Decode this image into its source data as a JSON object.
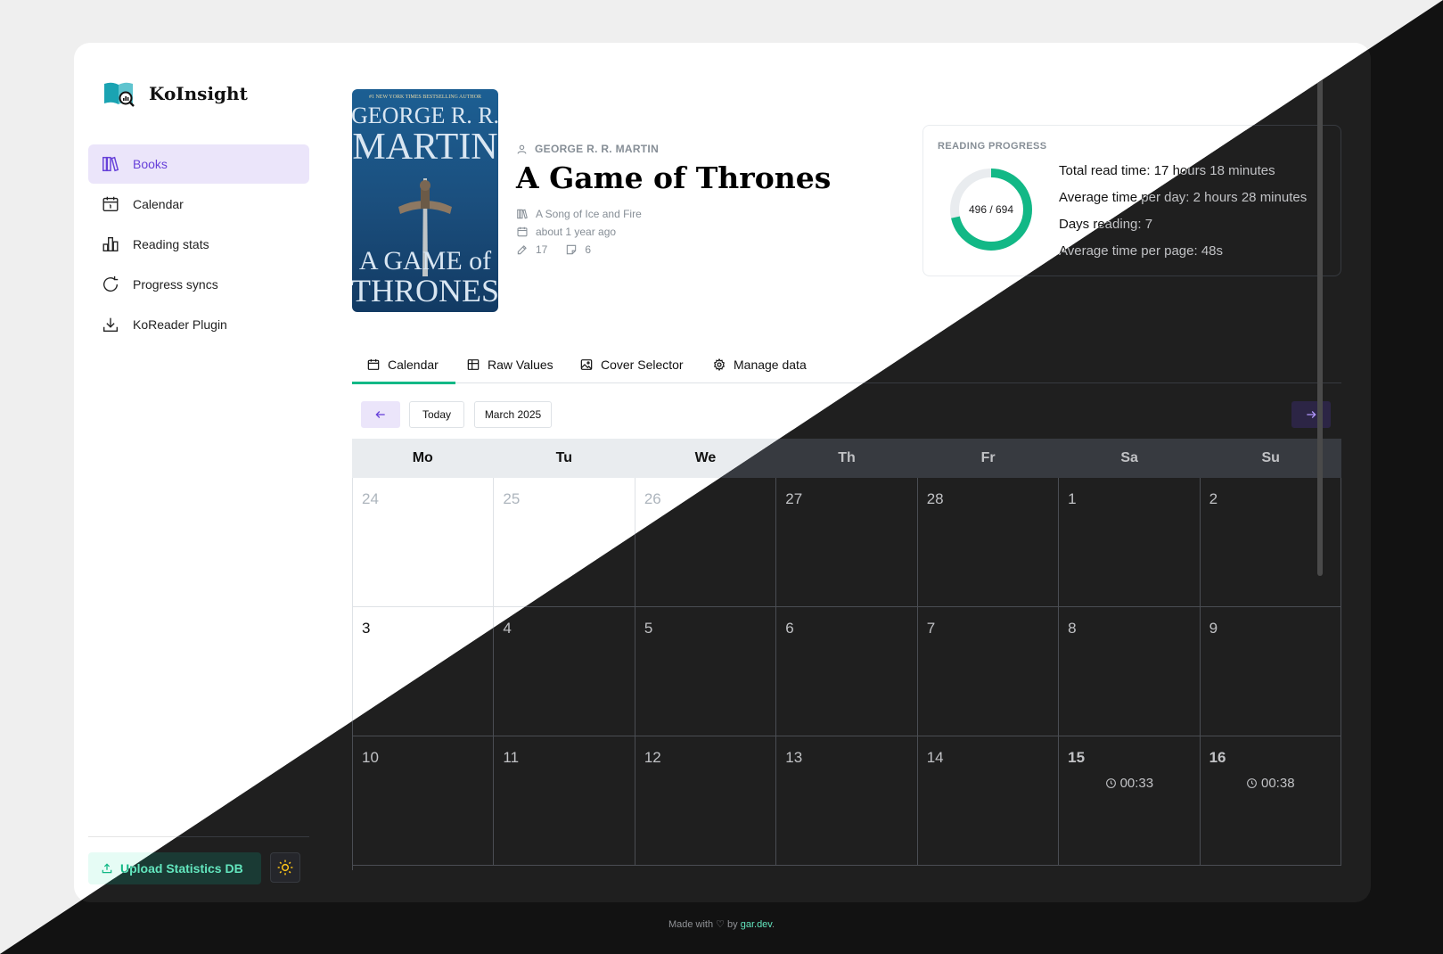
{
  "app": {
    "title": "KoInsight"
  },
  "sidebar": {
    "items": [
      {
        "label": "Books",
        "icon": "books-icon",
        "active": true
      },
      {
        "label": "Calendar",
        "icon": "calendar-icon",
        "active": false
      },
      {
        "label": "Reading stats",
        "icon": "bar-chart-icon",
        "active": false
      },
      {
        "label": "Progress syncs",
        "icon": "refresh-icon",
        "active": false
      },
      {
        "label": "KoReader Plugin",
        "icon": "download-icon",
        "active": false
      }
    ],
    "upload_label": "Upload Statistics DB",
    "theme_toggle_icon": "sun-icon"
  },
  "book": {
    "author": "GEORGE R. R. MARTIN",
    "title": "A Game of Thrones",
    "series": "A Song of Ice and Fire",
    "last_read": "about 1 year ago",
    "highlights": "17",
    "notes": "6",
    "cover": {
      "tagline": "#1 NEW YORK TIMES BESTSELLING AUTHOR",
      "author_line1": "GEORGE R. R.",
      "author_line2": "MARTIN",
      "title_line1": "A GAME of",
      "title_line2": "THRONES"
    }
  },
  "progress": {
    "label": "READING PROGRESS",
    "pages_read": 496,
    "pages_total": 694,
    "donut_text": "496 / 694",
    "total_read_time": "Total read time: 17 hours 18 minutes",
    "avg_time_per_day": "Average time per day: 2 hours 28 minutes",
    "days_reading": "Days reading: 7",
    "avg_time_per_page": "Average time per page: 48s"
  },
  "tabs": [
    {
      "label": "Calendar",
      "icon": "calendar-icon",
      "active": true
    },
    {
      "label": "Raw Values",
      "icon": "table-icon",
      "active": false
    },
    {
      "label": "Cover Selector",
      "icon": "image-icon",
      "active": false
    },
    {
      "label": "Manage data",
      "icon": "gear-icon",
      "active": false
    }
  ],
  "calendar": {
    "today_label": "Today",
    "month_label": "March 2025",
    "weekdays": [
      "Mo",
      "Tu",
      "We",
      "Th",
      "Fr",
      "Sa",
      "Su"
    ],
    "days": [
      {
        "n": "24",
        "muted": true
      },
      {
        "n": "25",
        "muted": true
      },
      {
        "n": "26",
        "muted": true
      },
      {
        "n": "27"
      },
      {
        "n": "28"
      },
      {
        "n": "1"
      },
      {
        "n": "2"
      },
      {
        "n": "3"
      },
      {
        "n": "4"
      },
      {
        "n": "5"
      },
      {
        "n": "6"
      },
      {
        "n": "7"
      },
      {
        "n": "8"
      },
      {
        "n": "9"
      },
      {
        "n": "10"
      },
      {
        "n": "11"
      },
      {
        "n": "12"
      },
      {
        "n": "13"
      },
      {
        "n": "14"
      },
      {
        "n": "15",
        "time": "00:33"
      },
      {
        "n": "16",
        "time": "00:38"
      }
    ]
  },
  "footer": {
    "prefix": "Made with ♡ by ",
    "link": "gar.dev",
    "suffix": "."
  },
  "colors": {
    "accent": "#12b886",
    "brand_purple": "#6741d9",
    "teal_icon": "#1aa3b2"
  }
}
